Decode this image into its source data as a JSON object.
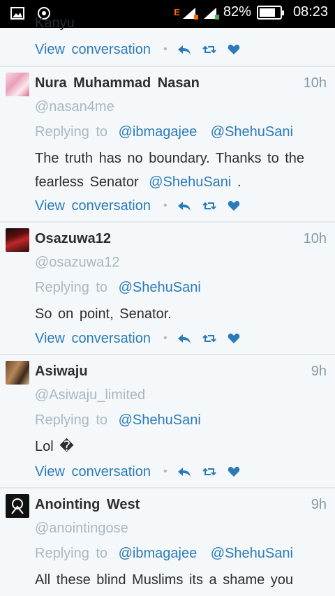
{
  "status": {
    "network": "E",
    "battery_text": "82%",
    "battery_level": 0.82,
    "time": "08:23"
  },
  "colors": {
    "link": "#2b7bb9",
    "muted": "#aab8c2",
    "text": "#292f33"
  },
  "partial_tweet": {
    "text": "Kanyu",
    "view_conversation": "View conversation"
  },
  "tweets": [
    {
      "name": "Nura Muhammad Nasan",
      "handle": "@nasan4me",
      "time": "10h",
      "replying_label": "Replying to",
      "replying_to": [
        "@ibmagajee",
        "@ShehuSani"
      ],
      "text_line1": "The truth has no boundary. Thanks to the",
      "text_line2_prefix": "fearless Senator",
      "text_mention": "@ShehuSani",
      "text_line2_suffix": ".",
      "view_conversation": "View conversation",
      "avatar_icon": "avatar-pink"
    },
    {
      "name": "Osazuwa12",
      "handle": "@osazuwa12",
      "time": "10h",
      "replying_label": "Replying to",
      "replying_to": [
        "@ShehuSani"
      ],
      "text": "So on point, Senator.",
      "view_conversation": "View conversation",
      "avatar_icon": "avatar-red"
    },
    {
      "name": "Asiwaju",
      "handle": "@Asiwaju_limited",
      "time": "9h",
      "replying_label": "Replying to",
      "replying_to": [
        "@ShehuSani"
      ],
      "text": "Lol �",
      "view_conversation": "View conversation",
      "avatar_icon": "avatar-brown"
    },
    {
      "name": "Anointing West",
      "handle": "@anointingose",
      "time": "9h",
      "replying_label": "Replying to",
      "replying_to": [
        "@ibmagajee",
        "@ShehuSani"
      ],
      "text": "All these blind Muslims its a shame you",
      "avatar_icon": "avatar-black"
    }
  ]
}
